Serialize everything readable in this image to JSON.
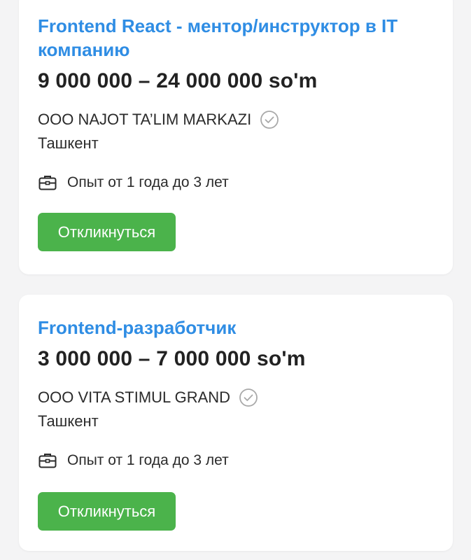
{
  "colors": {
    "title": "#2f8de4",
    "button": "#4bb34b",
    "background": "#f4f4f5",
    "card": "#ffffff"
  },
  "vacancies": [
    {
      "title": "Frontend React - ментор/инструктор в IT компанию",
      "salary": "9 000 000 – 24 000 000 so'm",
      "company": "OOO NAJOT TA’LIM MARKAZI",
      "company_icon": "verified-check-icon",
      "city": "Ташкент",
      "experience_icon": "briefcase-icon",
      "experience": "Опыт от 1 года до 3 лет",
      "button_label": "Откликнуться"
    },
    {
      "title": "Frontend-разработчик",
      "salary": "3 000 000 – 7 000 000 so'm",
      "company": "OOO VITA STIMUL GRAND",
      "company_icon": "verified-check-icon",
      "city": "Ташкент",
      "experience_icon": "briefcase-icon",
      "experience": "Опыт от 1 года до 3 лет",
      "button_label": "Откликнуться"
    }
  ]
}
